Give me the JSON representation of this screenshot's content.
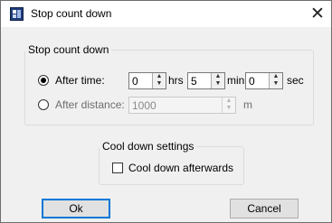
{
  "window": {
    "title": "Stop count down",
    "close_glyph": "✕"
  },
  "stop_group": {
    "legend": "Stop count down",
    "after_time": {
      "label": "After time:",
      "selected": true,
      "hours": {
        "value": "0",
        "unit": "hrs"
      },
      "minutes": {
        "value": "5",
        "unit": "min"
      },
      "seconds": {
        "value": "0",
        "unit": "sec"
      }
    },
    "after_distance": {
      "label": "After distance:",
      "selected": false,
      "value": "1000",
      "unit": "m"
    }
  },
  "cooldown_group": {
    "legend": "Cool down settings",
    "checkbox_label": "Cool down afterwards",
    "checked": false
  },
  "buttons": {
    "ok": "Ok",
    "cancel": "Cancel"
  },
  "icons": {
    "app": "stopwatch-app-icon",
    "spin_up": "▲",
    "spin_down": "▼"
  },
  "colors": {
    "accent": "#0078d7",
    "dialog_bg": "#f0f0f0",
    "title_bg": "#ffffff"
  }
}
